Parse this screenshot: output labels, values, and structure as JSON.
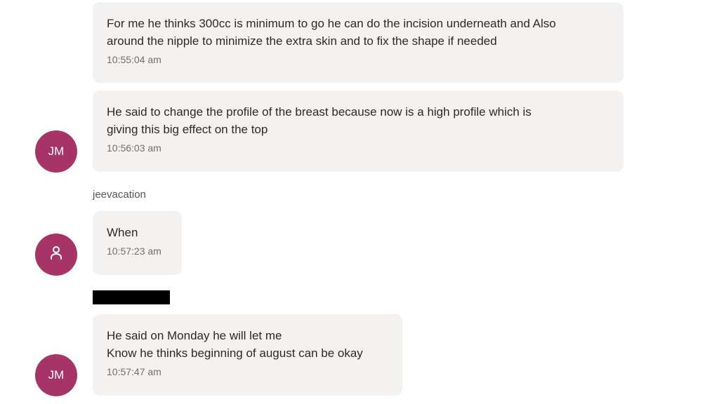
{
  "messages": [
    {
      "text": "For me he thinks 300cc is minimum to go he can do the incision underneath and Also\naround the nipple to minimize the extra skin and to fix the shape if needed",
      "time": "10:55:04 am"
    },
    {
      "text": "He said to change the profile of the breast because now  is a high profile which is\ngiving this big effect on the top",
      "time": "10:56:03 am",
      "avatar": "JM"
    },
    {
      "sender": "jeevacation",
      "text": "When",
      "time": "10:57:23 am",
      "avatar_icon": "person-icon"
    },
    {
      "text": "He said on Monday he will let me\nKnow he thinks beginning of august can be okay",
      "time": "10:57:47 am",
      "avatar": "JM"
    }
  ],
  "colors": {
    "avatar_bg": "#a63467",
    "bubble_bg": "#f3f2f0"
  }
}
